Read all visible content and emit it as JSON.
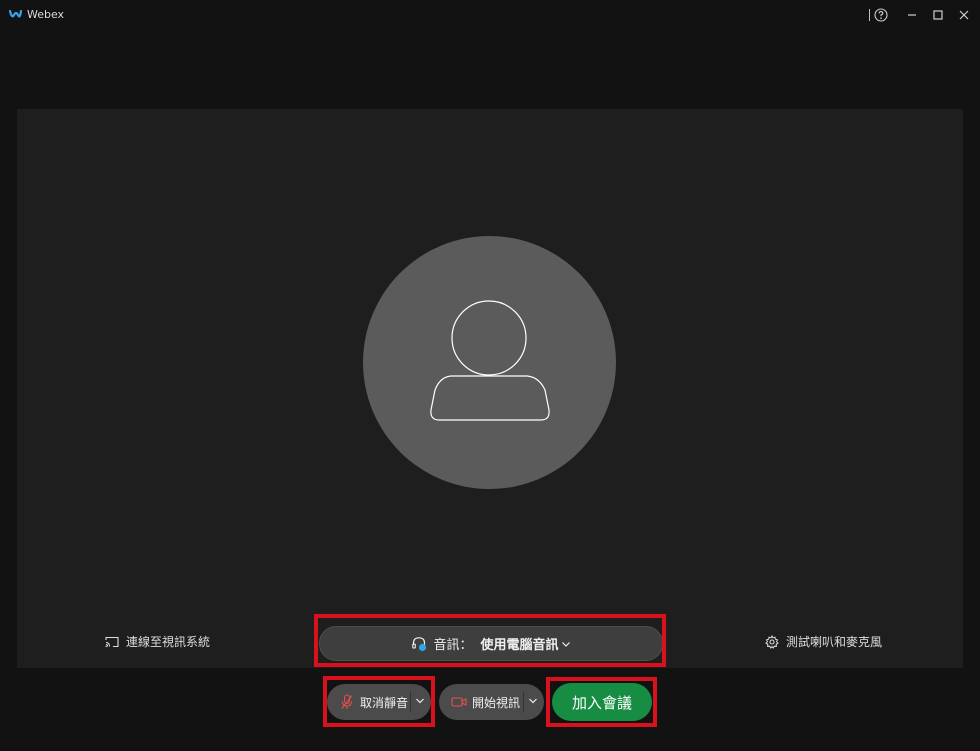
{
  "window": {
    "title": "Webex"
  },
  "titlebar": {
    "icons": [
      "help-icon",
      "minimize-icon",
      "maximize-icon",
      "close-icon"
    ]
  },
  "preview": {
    "connect_label": "連線至視訊系統",
    "audio_prefix": "音訊：",
    "audio_value": "使用電腦音訊",
    "test_label": "測試喇叭和麥克風"
  },
  "controls": {
    "unmute_label": "取消靜音",
    "video_label": "開始視訊",
    "join_label": "加入會議"
  },
  "colors": {
    "background": "#121212",
    "preview_bg": "#1e1e1e",
    "join_green": "#168d43",
    "highlight_red": "#d8121c",
    "video_icon_red": "#e5504a",
    "audio_badge_blue": "#29a9e0"
  }
}
